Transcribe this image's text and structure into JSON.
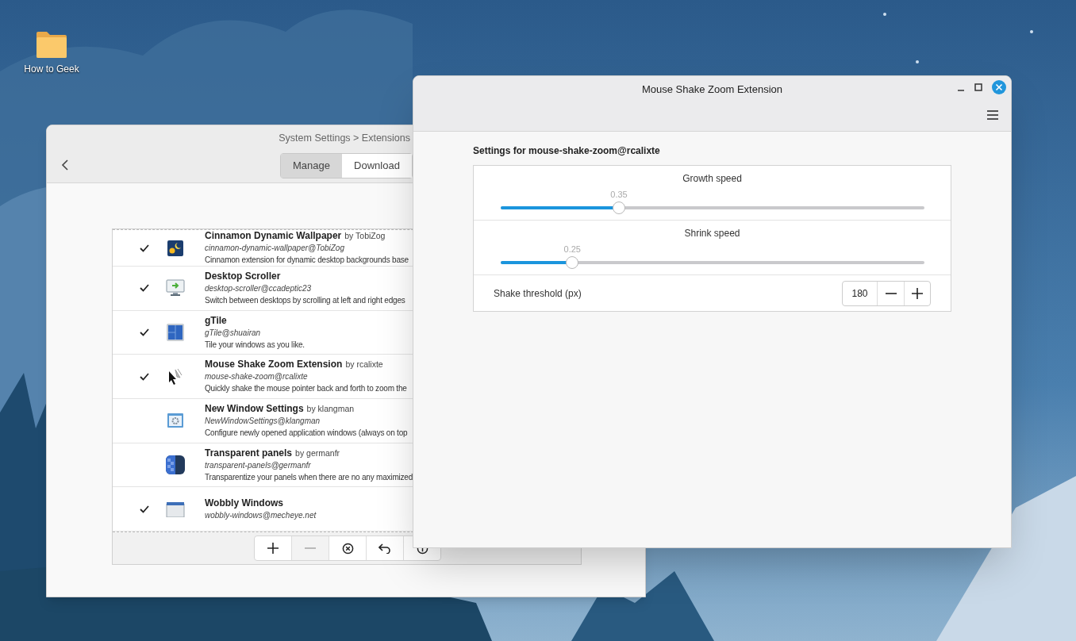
{
  "desktop": {
    "icons": [
      {
        "label": "How to Geek"
      }
    ]
  },
  "settings_window": {
    "title": "System Settings > Extensions",
    "tabs": [
      {
        "label": "Manage",
        "selected": true
      },
      {
        "label": "Download",
        "selected": false
      }
    ],
    "extensions": [
      {
        "name": "Cinnamon Dynamic Wallpaper",
        "byline": "by TobiZog",
        "uuid": "cinnamon-dynamic-wallpaper@TobiZog",
        "description": "Cinnamon extension for dynamic desktop backgrounds base",
        "enabled": true
      },
      {
        "name": "Desktop Scroller",
        "uuid": "desktop-scroller@ccadeptic23",
        "description": "Switch between desktops by scrolling at left and right edges",
        "enabled": true
      },
      {
        "name": "gTile",
        "uuid": "gTile@shuairan",
        "description": "Tile your windows as you like.",
        "enabled": true
      },
      {
        "name": "Mouse Shake Zoom Extension",
        "byline": "by rcalixte",
        "uuid": "mouse-shake-zoom@rcalixte",
        "description": "Quickly shake the mouse pointer back and forth to zoom the",
        "enabled": true
      },
      {
        "name": "New Window Settings",
        "byline": "by klangman",
        "uuid": "NewWindowSettings@klangman",
        "description": "Configure newly opened application windows (always on top",
        "enabled": false
      },
      {
        "name": "Transparent panels",
        "byline": "by germanfr",
        "uuid": "transparent-panels@germanfr",
        "description": "Transparentize your panels when there are no any maximized",
        "enabled": false
      },
      {
        "name": "Wobbly Windows",
        "uuid": "wobbly-windows@mecheye.net",
        "enabled": true
      }
    ]
  },
  "extension_window": {
    "title": "Mouse Shake Zoom Extension",
    "heading": "Settings for mouse-shake-zoom@rcalixte",
    "sliders": [
      {
        "label": "Growth speed",
        "reading": "0.35",
        "level": 0.28
      },
      {
        "label": "Shrink speed",
        "reading": "0.25",
        "level": 0.17
      }
    ],
    "spin": {
      "label": "Shake threshold (px)",
      "value": "180"
    }
  }
}
